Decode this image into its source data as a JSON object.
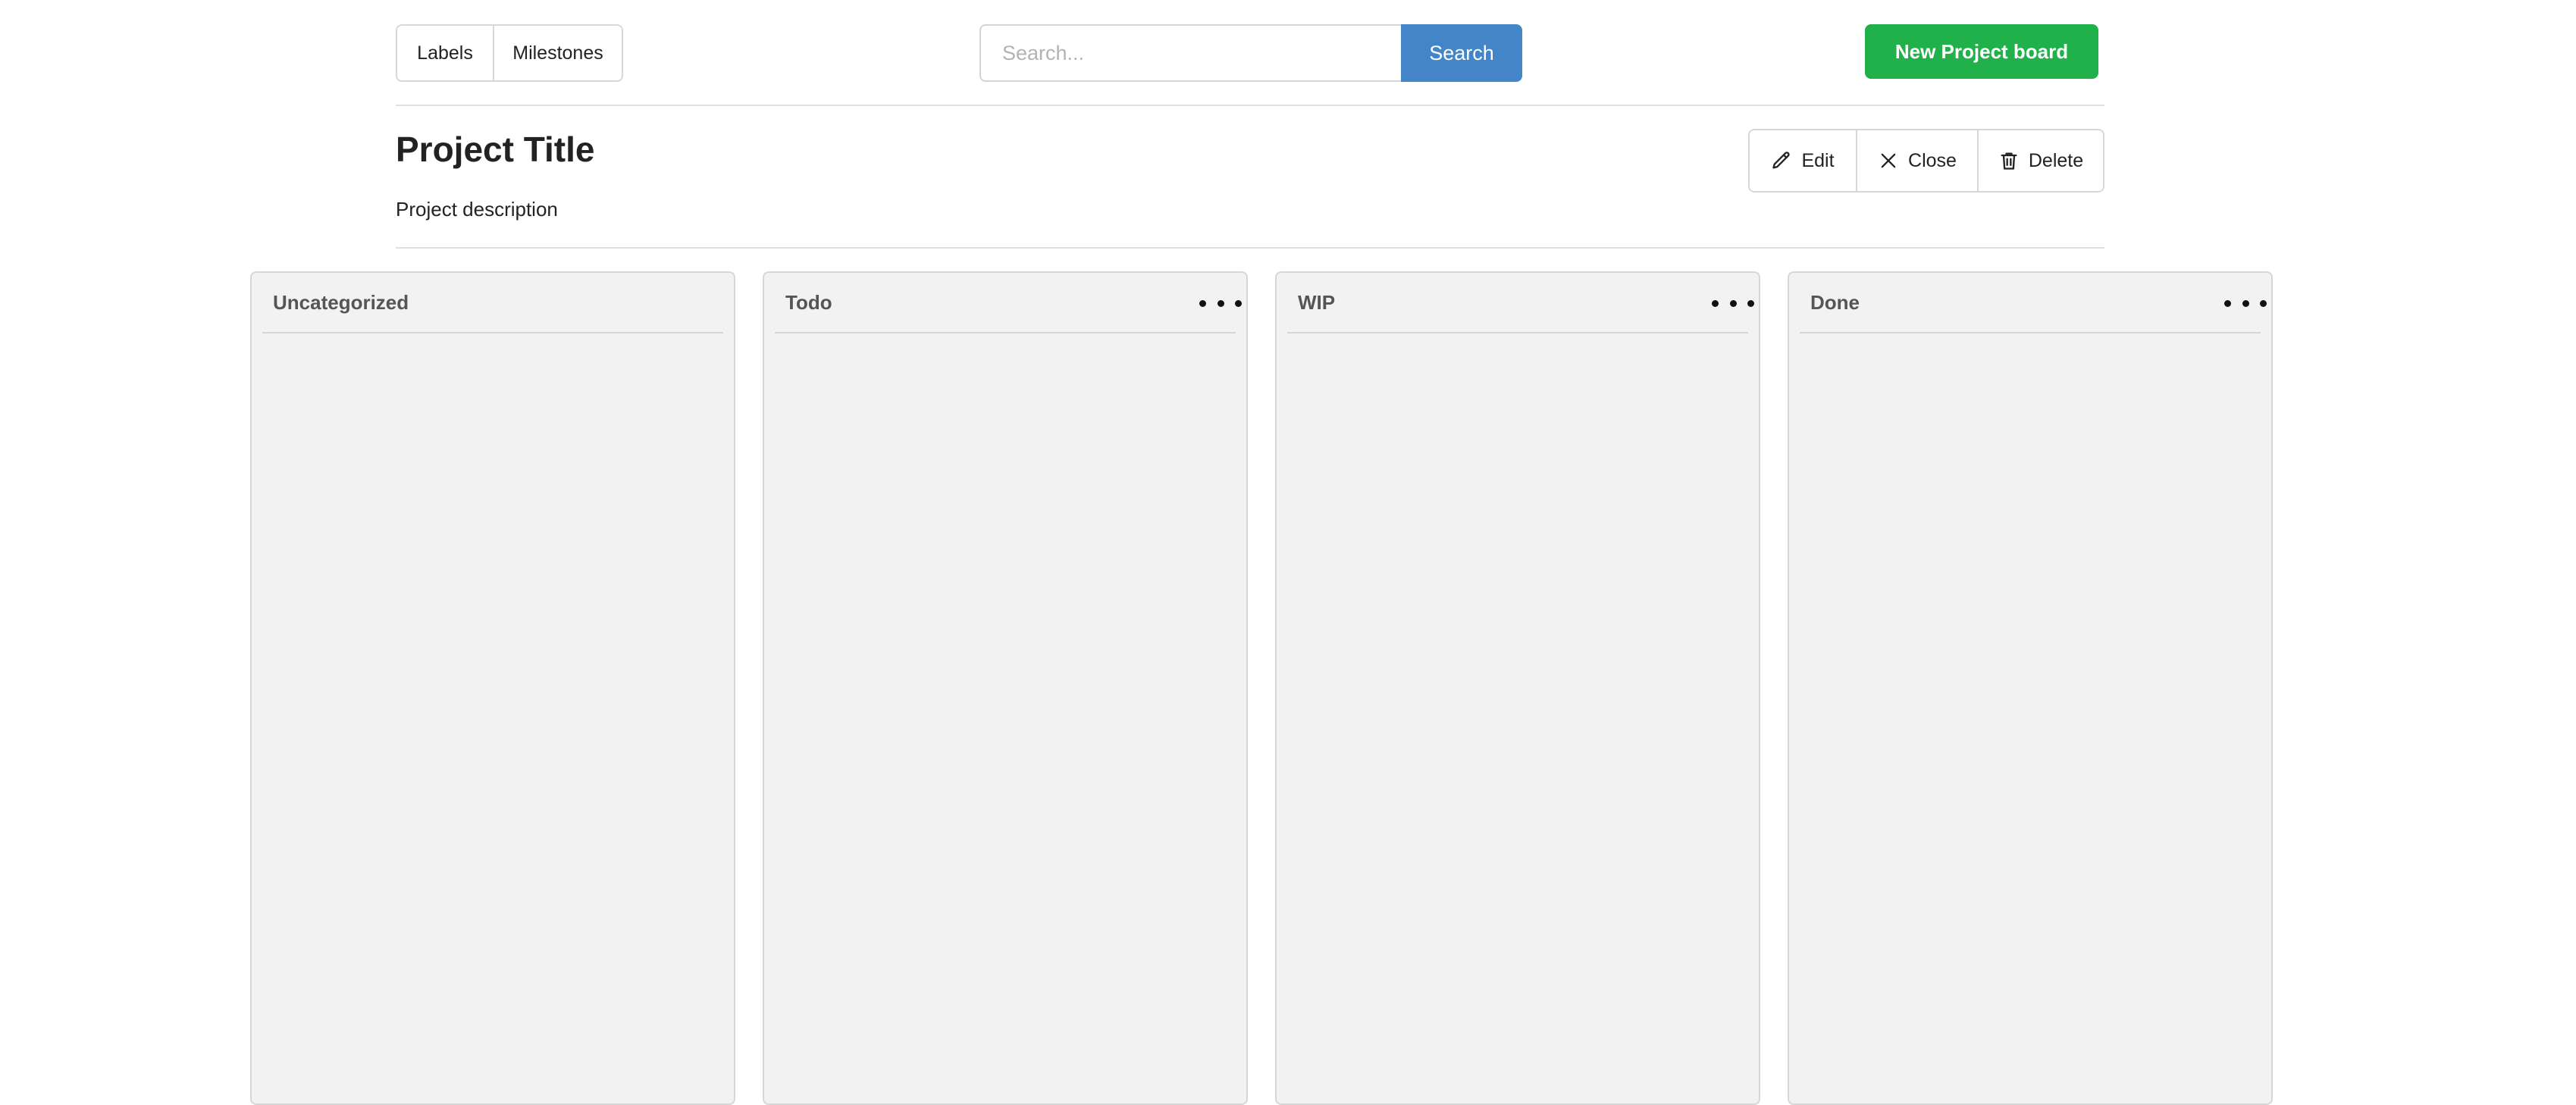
{
  "header": {
    "nav": {
      "labels": "Labels",
      "milestones": "Milestones"
    },
    "search": {
      "placeholder": "Search...",
      "value": "",
      "button_label": "Search"
    },
    "new_board_label": "New Project board"
  },
  "project": {
    "title": "Project Title",
    "description": "Project description",
    "actions": {
      "edit": "Edit",
      "close": "Close",
      "delete": "Delete"
    }
  },
  "columns": [
    {
      "title": "Uncategorized",
      "has_menu": false
    },
    {
      "title": "Todo",
      "has_menu": true
    },
    {
      "title": "WIP",
      "has_menu": true
    },
    {
      "title": "Done",
      "has_menu": true
    }
  ],
  "icons": {
    "edit": "pencil-icon",
    "close": "x-icon",
    "delete": "trash-icon",
    "column_menu": "kebab-menu-icon"
  },
  "colors": {
    "search_button": "#4385c7",
    "new_board_button": "#21b14b",
    "column_background": "#f2f2f2"
  }
}
